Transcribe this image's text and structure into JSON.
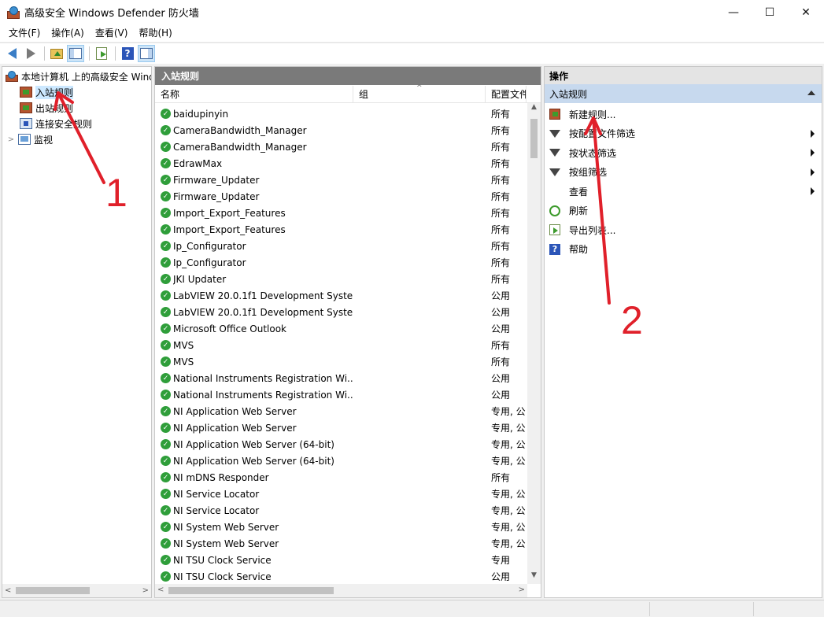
{
  "window": {
    "title": "高级安全 Windows Defender 防火墙",
    "minimize": "—",
    "maximize": "☐",
    "close": "✕"
  },
  "menu": [
    "文件(F)",
    "操作(A)",
    "查看(V)",
    "帮助(H)"
  ],
  "tree": {
    "root": "本地计算机 上的高级安全 Windows Defender 防火墙",
    "items": [
      {
        "label": "入站规则",
        "icon": "inbound-rules-icon",
        "selected": true
      },
      {
        "label": "出站规则",
        "icon": "outbound-rules-icon",
        "selected": false
      },
      {
        "label": "连接安全规则",
        "icon": "connection-security-icon",
        "selected": false
      },
      {
        "label": "监视",
        "icon": "monitor-icon",
        "selected": false
      }
    ]
  },
  "list": {
    "header": "入站规则",
    "columns": [
      "名称",
      "组",
      "配置文件"
    ],
    "rows": [
      {
        "name": "baidupinyin",
        "profile": "所有"
      },
      {
        "name": "CameraBandwidth_Manager",
        "profile": "所有"
      },
      {
        "name": "CameraBandwidth_Manager",
        "profile": "所有"
      },
      {
        "name": "EdrawMax",
        "profile": "所有"
      },
      {
        "name": "Firmware_Updater",
        "profile": "所有"
      },
      {
        "name": "Firmware_Updater",
        "profile": "所有"
      },
      {
        "name": "Import_Export_Features",
        "profile": "所有"
      },
      {
        "name": "Import_Export_Features",
        "profile": "所有"
      },
      {
        "name": "Ip_Configurator",
        "profile": "所有"
      },
      {
        "name": "Ip_Configurator",
        "profile": "所有"
      },
      {
        "name": "JKI Updater",
        "profile": "所有"
      },
      {
        "name": "LabVIEW 20.0.1f1 Development Syste...",
        "profile": "公用"
      },
      {
        "name": "LabVIEW 20.0.1f1 Development Syste...",
        "profile": "公用"
      },
      {
        "name": "Microsoft Office Outlook",
        "profile": "公用"
      },
      {
        "name": "MVS",
        "profile": "所有"
      },
      {
        "name": "MVS",
        "profile": "所有"
      },
      {
        "name": "National Instruments Registration Wi...",
        "profile": "公用"
      },
      {
        "name": "National Instruments Registration Wi...",
        "profile": "公用"
      },
      {
        "name": "NI Application Web Server",
        "profile": "专用, 公"
      },
      {
        "name": "NI Application Web Server",
        "profile": "专用, 公"
      },
      {
        "name": "NI Application Web Server (64-bit)",
        "profile": "专用, 公"
      },
      {
        "name": "NI Application Web Server (64-bit)",
        "profile": "专用, 公"
      },
      {
        "name": "NI mDNS Responder",
        "profile": "所有"
      },
      {
        "name": "NI Service Locator",
        "profile": "专用, 公"
      },
      {
        "name": "NI Service Locator",
        "profile": "专用, 公"
      },
      {
        "name": "NI System Web Server",
        "profile": "专用, 公"
      },
      {
        "name": "NI System Web Server",
        "profile": "专用, 公"
      },
      {
        "name": "NI TSU Clock Service",
        "profile": "专用"
      },
      {
        "name": "NI TSU Clock Service",
        "profile": "公用"
      }
    ]
  },
  "actions": {
    "title": "操作",
    "section": "入站规则",
    "items": [
      {
        "label": "新建规则...",
        "icon": "new-rule-icon",
        "submenu": false
      },
      {
        "label": "按配置文件筛选",
        "icon": "filter-icon",
        "submenu": true
      },
      {
        "label": "按状态筛选",
        "icon": "filter-icon",
        "submenu": true
      },
      {
        "label": "按组筛选",
        "icon": "filter-icon",
        "submenu": true
      },
      {
        "label": "查看",
        "icon": "",
        "submenu": true
      },
      {
        "label": "刷新",
        "icon": "refresh-icon",
        "submenu": false
      },
      {
        "label": "导出列表...",
        "icon": "export-icon",
        "submenu": false
      },
      {
        "label": "帮助",
        "icon": "help-icon",
        "submenu": false
      }
    ]
  },
  "annotations": {
    "label1": "1",
    "label2": "2",
    "color": "#e0202a"
  }
}
